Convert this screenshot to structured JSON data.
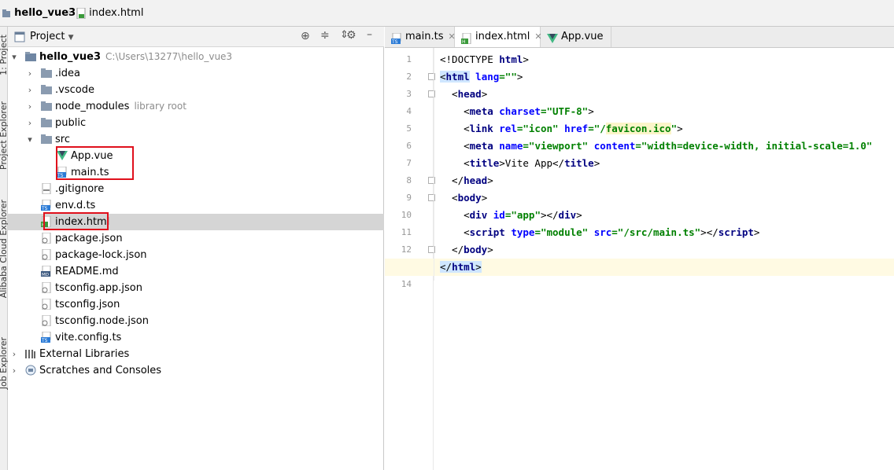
{
  "breadcrumb": {
    "project": "hello_vue3",
    "file": "index.html"
  },
  "left_strip": {
    "tabs": [
      "1: Project",
      "Project Explorer",
      "Alibaba Cloud Explorer",
      "Job Explorer"
    ]
  },
  "project_panel": {
    "title": "Project",
    "tree": [
      {
        "label": "hello_vue3",
        "hint": "C:\\Users\\13277\\hello_vue3",
        "icon": "folder-module-icon",
        "arrow": "▾",
        "level": 0
      },
      {
        "label": ".idea",
        "icon": "folder-icon",
        "arrow": "›",
        "level": 1
      },
      {
        "label": ".vscode",
        "icon": "folder-icon",
        "arrow": "›",
        "level": 1
      },
      {
        "label": "node_modules",
        "hint": "library root",
        "icon": "folder-icon",
        "arrow": "›",
        "level": 1
      },
      {
        "label": "public",
        "icon": "folder-icon",
        "arrow": "›",
        "level": 1
      },
      {
        "label": "src",
        "icon": "folder-icon",
        "arrow": "▾",
        "level": 1
      },
      {
        "label": "App.vue",
        "icon": "vue-file-icon",
        "level": 2
      },
      {
        "label": "main.ts",
        "icon": "ts-file-icon",
        "level": 2
      },
      {
        "label": ".gitignore",
        "icon": "gitignore-file-icon",
        "level": 1
      },
      {
        "label": "env.d.ts",
        "icon": "ts-file-icon",
        "level": 1
      },
      {
        "label": "index.html",
        "icon": "html-file-icon",
        "level": 1,
        "selected": true
      },
      {
        "label": "package.json",
        "icon": "json-file-icon",
        "level": 1
      },
      {
        "label": "package-lock.json",
        "icon": "json-file-icon",
        "level": 1
      },
      {
        "label": "README.md",
        "icon": "md-file-icon",
        "level": 1
      },
      {
        "label": "tsconfig.app.json",
        "icon": "json-file-icon",
        "level": 1
      },
      {
        "label": "tsconfig.json",
        "icon": "json-file-icon",
        "level": 1
      },
      {
        "label": "tsconfig.node.json",
        "icon": "json-file-icon",
        "level": 1
      },
      {
        "label": "vite.config.ts",
        "icon": "ts-file-icon",
        "level": 1
      },
      {
        "label": "External Libraries",
        "icon": "library-icon",
        "arrow": "›",
        "level": 0
      },
      {
        "label": "Scratches and Consoles",
        "icon": "scratches-icon",
        "arrow": "›",
        "level": 0
      }
    ]
  },
  "tabs": [
    {
      "label": "main.ts",
      "icon": "ts-file-icon",
      "active": false
    },
    {
      "label": "index.html",
      "icon": "html-file-icon",
      "active": true
    },
    {
      "label": "App.vue",
      "icon": "vue-file-icon",
      "active": false
    }
  ],
  "editor": {
    "current_line": 13,
    "lines": [
      [
        [
          "tx",
          "<!DOCTYPE "
        ],
        [
          "tg",
          "html"
        ],
        [
          "tx",
          ">"
        ]
      ],
      [
        [
          "tx hl",
          "<"
        ],
        [
          "tg hl",
          "html"
        ],
        [
          "tx",
          " "
        ],
        [
          "at",
          "lang"
        ],
        [
          "st",
          "=\"\""
        ],
        [
          "tx",
          ">"
        ]
      ],
      [
        [
          "tx",
          "  <"
        ],
        [
          "tg",
          "head"
        ],
        [
          "tx",
          ">"
        ]
      ],
      [
        [
          "tx",
          "    <"
        ],
        [
          "tg",
          "meta"
        ],
        [
          "tx",
          " "
        ],
        [
          "at",
          "charset"
        ],
        [
          "st",
          "=\"UTF-8\""
        ],
        [
          "tx",
          ">"
        ]
      ],
      [
        [
          "tx",
          "    <"
        ],
        [
          "tg",
          "link"
        ],
        [
          "tx",
          " "
        ],
        [
          "at",
          "rel"
        ],
        [
          "st",
          "=\"icon\""
        ],
        [
          "tx",
          " "
        ],
        [
          "at",
          "href"
        ],
        [
          "st",
          "=\"/"
        ],
        [
          "st lnk",
          "favicon.ico"
        ],
        [
          "st",
          "\""
        ],
        [
          "tx",
          ">"
        ]
      ],
      [
        [
          "tx",
          "    <"
        ],
        [
          "tg",
          "meta"
        ],
        [
          "tx",
          " "
        ],
        [
          "at",
          "name"
        ],
        [
          "st",
          "=\"viewport\""
        ],
        [
          "tx",
          " "
        ],
        [
          "at",
          "content"
        ],
        [
          "st",
          "=\"width=device-width, initial-scale=1.0\""
        ]
      ],
      [
        [
          "tx",
          "    <"
        ],
        [
          "tg",
          "title"
        ],
        [
          "tx",
          ">Vite App</"
        ],
        [
          "tg",
          "title"
        ],
        [
          "tx",
          ">"
        ]
      ],
      [
        [
          "tx",
          "  </"
        ],
        [
          "tg",
          "head"
        ],
        [
          "tx",
          ">"
        ]
      ],
      [
        [
          "tx",
          "  <"
        ],
        [
          "tg",
          "body"
        ],
        [
          "tx",
          ">"
        ]
      ],
      [
        [
          "tx",
          "    <"
        ],
        [
          "tg",
          "div"
        ],
        [
          "tx",
          " "
        ],
        [
          "at",
          "id"
        ],
        [
          "st",
          "=\"app\""
        ],
        [
          "tx",
          "></"
        ],
        [
          "tg",
          "div"
        ],
        [
          "tx",
          ">"
        ]
      ],
      [
        [
          "tx",
          "    <"
        ],
        [
          "tg",
          "script"
        ],
        [
          "tx",
          " "
        ],
        [
          "at",
          "type"
        ],
        [
          "st",
          "=\"module\""
        ],
        [
          "tx",
          " "
        ],
        [
          "at",
          "src"
        ],
        [
          "st",
          "=\"/src/main.ts\""
        ],
        [
          "tx",
          "></"
        ],
        [
          "tg",
          "script"
        ],
        [
          "tx",
          ">"
        ]
      ],
      [
        [
          "tx",
          "  </"
        ],
        [
          "tg",
          "body"
        ],
        [
          "tx",
          ">"
        ]
      ],
      [
        [
          "tx hl",
          "</"
        ],
        [
          "tg hl",
          "html"
        ],
        [
          "tx hl",
          ">"
        ]
      ],
      []
    ]
  },
  "colors": {
    "selection_box": "#e0101c",
    "vue_green": "#41b883",
    "ts_blue": "#2b7bd6",
    "folder": "#8a9bb0"
  }
}
